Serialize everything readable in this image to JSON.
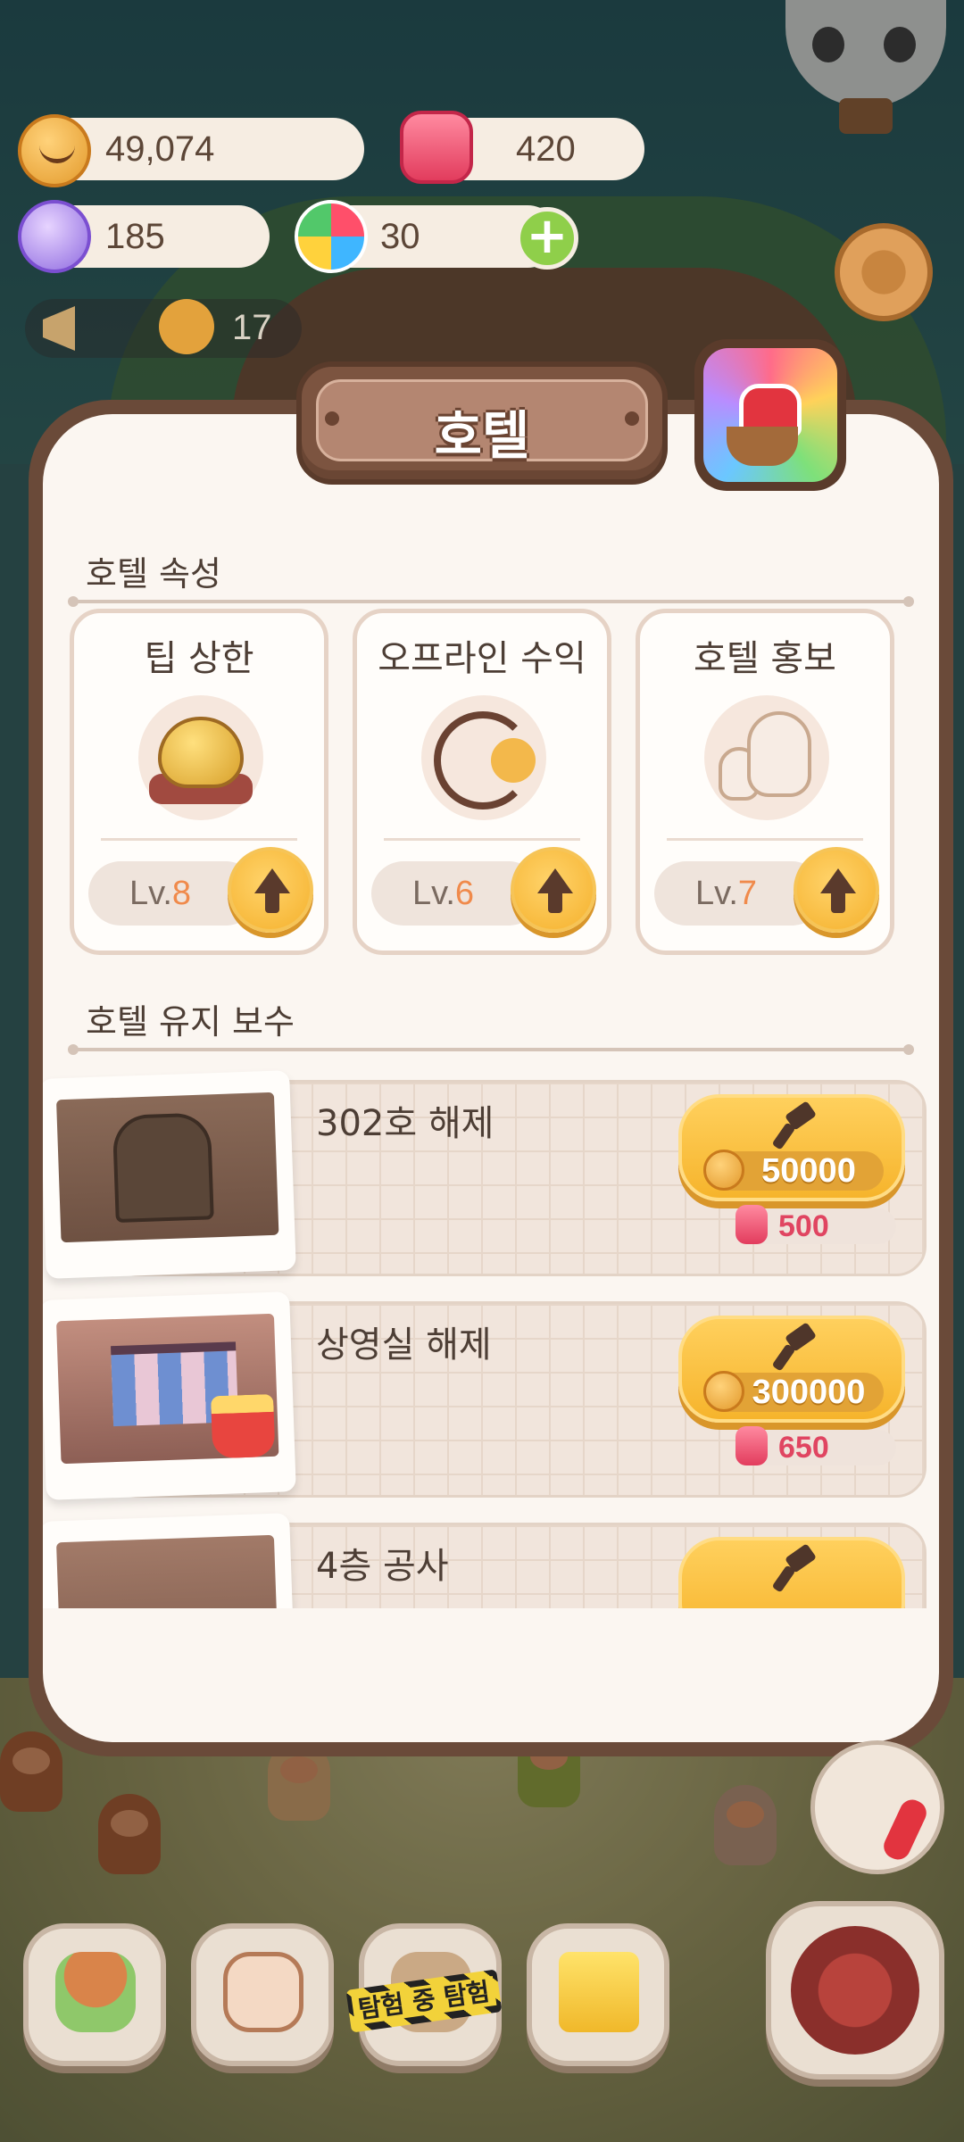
{
  "resources": {
    "cookies": "49,074",
    "candles": "420",
    "candy": "185",
    "clovers": "30"
  },
  "notice": {
    "count": "17"
  },
  "hotel": {
    "title": "호텔",
    "attributes_title": "호텔 속성",
    "attributes": [
      {
        "name": "팁 상한",
        "level_prefix": "Lv.",
        "level": "8",
        "icon": "piggy-bank-icon"
      },
      {
        "name": "오프라인 수익",
        "level_prefix": "Lv.",
        "level": "6",
        "icon": "clock-cookie-icon"
      },
      {
        "name": "호텔 홍보",
        "level_prefix": "Lv.",
        "level": "7",
        "icon": "mascot-pair-icon"
      }
    ],
    "maintenance_title": "호텔 유지 보수",
    "maintenance": [
      {
        "name": "302호 해제",
        "cookie_cost": "50000",
        "candle_cost": "500"
      },
      {
        "name": "상영실 해제",
        "cookie_cost": "300000",
        "candle_cost": "650"
      },
      {
        "name": "4층 공사",
        "cookie_cost": "",
        "candle_cost": ""
      }
    ]
  },
  "bottom_nav": {
    "tape_label": "탐험 중 탐험"
  },
  "colors": {
    "panel_frame": "#6a4a39",
    "panel_bg": "#fbf6f1",
    "accent_button": "#f6b42c",
    "level_number": "#f08a4b",
    "candle_red": "#e04561",
    "plus_green": "#8fcf4a"
  }
}
